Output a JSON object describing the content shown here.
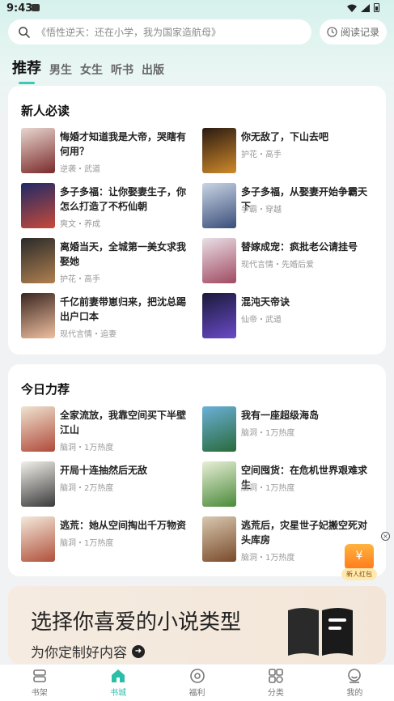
{
  "status": {
    "time": "9:43"
  },
  "search": {
    "placeholder": "《悟性逆天：还在小学，我为国家造航母》",
    "history_label": "阅读记录"
  },
  "tabs": [
    {
      "label": "推荐",
      "active": true
    },
    {
      "label": "男生"
    },
    {
      "label": "女生"
    },
    {
      "label": "听书"
    },
    {
      "label": "出版"
    }
  ],
  "section_new": {
    "title": "新人必读",
    "books": [
      {
        "title": "悔婚才知道我是大帝，哭瞎有何用？",
        "meta": "逆袭・武道",
        "cover_colors": [
          "#e8d6cf",
          "#7a2a2a"
        ]
      },
      {
        "title": "你无敌了，下山去吧",
        "meta": "护花・高手",
        "cover_colors": [
          "#2a1a12",
          "#d08a2a"
        ]
      },
      {
        "title": "多子多福：让你娶妻生子，你怎么打造了不朽仙朝",
        "meta": "爽文・养成",
        "cover_colors": [
          "#1e2a66",
          "#c84a3a"
        ]
      },
      {
        "title": "多子多福，从娶妻开始争霸天下",
        "meta": "争霸・穿越",
        "cover_colors": [
          "#c9d4e4",
          "#3a4e7a"
        ]
      },
      {
        "title": "离婚当天，全城第一美女求我娶她",
        "meta": "护花・高手",
        "cover_colors": [
          "#2a2a2a",
          "#b08050"
        ]
      },
      {
        "title": "替嫁成宠：疯批老公请挂号",
        "meta": "现代言情・先婚后爱",
        "cover_colors": [
          "#e9dfe5",
          "#a04a62"
        ]
      },
      {
        "title": "千亿前妻带崽归来，把沈总踢出户口本",
        "meta": "现代言情・追妻",
        "cover_colors": [
          "#3a2620",
          "#f0c0a0"
        ]
      },
      {
        "title": "混沌天帝诀",
        "meta": "仙帝・武道",
        "cover_colors": [
          "#1a1a3a",
          "#6a4ac8"
        ]
      }
    ]
  },
  "section_today": {
    "title": "今日力荐",
    "books": [
      {
        "title": "全家流放，我靠空间买下半壁江山",
        "meta": "脑洞・1万热度",
        "cover_colors": [
          "#efe3d0",
          "#b04a3a"
        ]
      },
      {
        "title": "我有一座超级海岛",
        "meta": "脑洞・1万热度",
        "cover_colors": [
          "#6ab0d8",
          "#2a6a3a"
        ]
      },
      {
        "title": "开局十连抽然后无敌",
        "meta": "脑洞・2万热度",
        "cover_colors": [
          "#f2f0ea",
          "#3a3a3a"
        ]
      },
      {
        "title": "空间囤货：在危机世界艰难求生",
        "meta": "脑洞・1万热度",
        "cover_colors": [
          "#e8efd6",
          "#4a8a3a"
        ]
      },
      {
        "title": "逃荒：她从空间掏出千万物资",
        "meta": "脑洞・1万热度",
        "cover_colors": [
          "#f3eadc",
          "#b0503a"
        ]
      },
      {
        "title": "逃荒后，灾星世子妃搬空死对头库房",
        "meta": "脑洞・1万热度",
        "cover_colors": [
          "#d8c8b0",
          "#7a4a2a"
        ]
      }
    ]
  },
  "banner": {
    "title": "选择你喜爱的小说类型",
    "subtitle": "为你定制好内容"
  },
  "float": {
    "close": "×",
    "redpack_label": "新人红包",
    "redpack_symbol": "¥"
  },
  "bottom_nav": [
    {
      "label": "书架",
      "icon": "bookshelf-icon"
    },
    {
      "label": "书城",
      "icon": "bookstore-icon",
      "active": true
    },
    {
      "label": "福利",
      "icon": "welfare-icon"
    },
    {
      "label": "分类",
      "icon": "category-icon"
    },
    {
      "label": "我的",
      "icon": "profile-icon"
    }
  ]
}
